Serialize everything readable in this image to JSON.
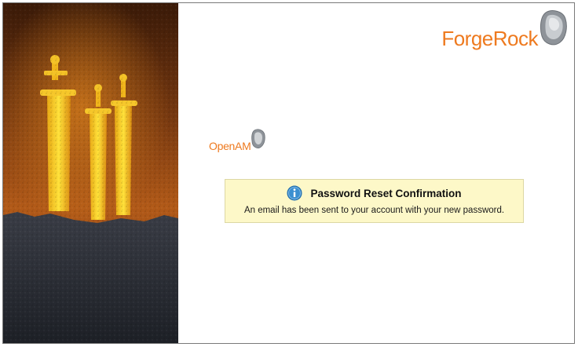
{
  "brand": {
    "name": "ForgeRock",
    "color": "#ee7a1f"
  },
  "product": {
    "name": "OpenAM",
    "color": "#ee7a1f"
  },
  "notice": {
    "icon": "info-icon",
    "title": "Password Reset Confirmation",
    "message": "An email has been sent to your account with your new password.",
    "background": "#fdf8c8"
  },
  "side_image": {
    "icon": "swords-in-rock-image"
  }
}
